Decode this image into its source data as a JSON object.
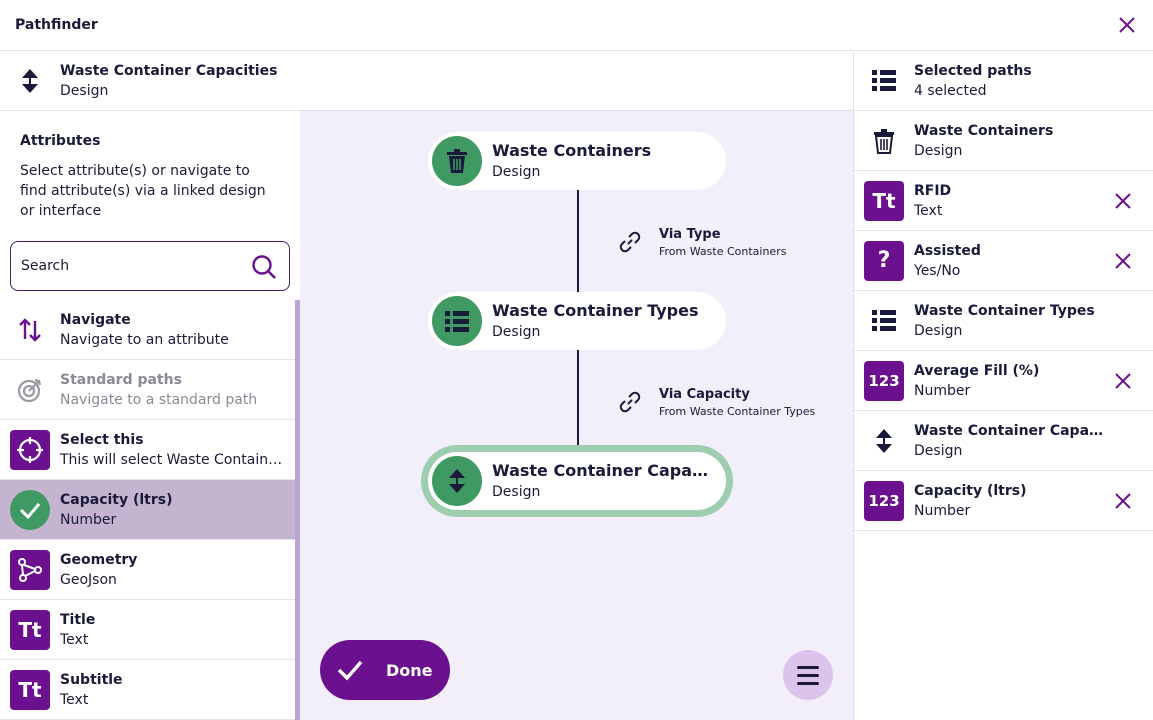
{
  "header": {
    "title": "Pathfinder"
  },
  "current": {
    "title": "Waste Container Capacities",
    "subtitle": "Design"
  },
  "attributes": {
    "heading": "Attributes",
    "description": "Select attribute(s) or navigate to find attribute(s) via a linked design or interface",
    "search_placeholder": "Search",
    "items": [
      {
        "title": "Navigate",
        "subtitle": "Navigate to an attribute",
        "icon": "navigate-arrows-icon"
      },
      {
        "title": "Standard paths",
        "subtitle": "Navigate to a standard path",
        "icon": "target-icon"
      },
      {
        "title": "Select this",
        "subtitle": "This will select Waste Container Capacities",
        "icon": "crosshair-icon"
      },
      {
        "title": "Capacity (ltrs)",
        "subtitle": "Number",
        "icon": "check-circle-icon"
      },
      {
        "title": "Geometry",
        "subtitle": "GeoJson",
        "icon": "geometry-icon"
      },
      {
        "title": "Title",
        "subtitle": "Text",
        "icon": "text-icon",
        "badge": "Tt"
      },
      {
        "title": "Subtitle",
        "subtitle": "Text",
        "icon": "text-icon",
        "badge": "Tt"
      }
    ]
  },
  "graph": {
    "nodes": [
      {
        "title": "Waste Containers",
        "subtitle": "Design",
        "icon": "trash-icon"
      },
      {
        "title": "Waste Container Types",
        "subtitle": "Design",
        "icon": "list-icon"
      },
      {
        "title": "Waste Container Capacities",
        "subtitle": "Design",
        "icon": "sort-icon"
      }
    ],
    "links": [
      {
        "label": "Via Type",
        "from": "From Waste Containers"
      },
      {
        "label": "Via Capacity",
        "from": "From Waste Container Types"
      }
    ],
    "done_label": "Done"
  },
  "selected": {
    "title": "Selected paths",
    "count": "4 selected",
    "items": [
      {
        "title": "Waste Containers",
        "subtitle": "Design",
        "icon": "trash-icon"
      },
      {
        "title": "RFID",
        "subtitle": "Text",
        "icon": "text-icon",
        "badge": "Tt"
      },
      {
        "title": "Assisted",
        "subtitle": "Yes/No",
        "icon": "question-icon",
        "badge": "?"
      },
      {
        "title": "Waste Container Types",
        "subtitle": "Design",
        "icon": "list-icon"
      },
      {
        "title": "Average Fill (%)",
        "subtitle": "Number",
        "icon": "number-icon",
        "badge": "123"
      },
      {
        "title": "Waste Container Capacities",
        "subtitle": "Design",
        "icon": "sort-icon"
      },
      {
        "title": "Capacity (ltrs)",
        "subtitle": "Number",
        "icon": "number-icon",
        "badge": "123"
      }
    ]
  },
  "colors": {
    "accent": "#6b118f",
    "green": "#3e9a62",
    "canvas": "#f2eefa",
    "text": "#1a1a3a"
  }
}
